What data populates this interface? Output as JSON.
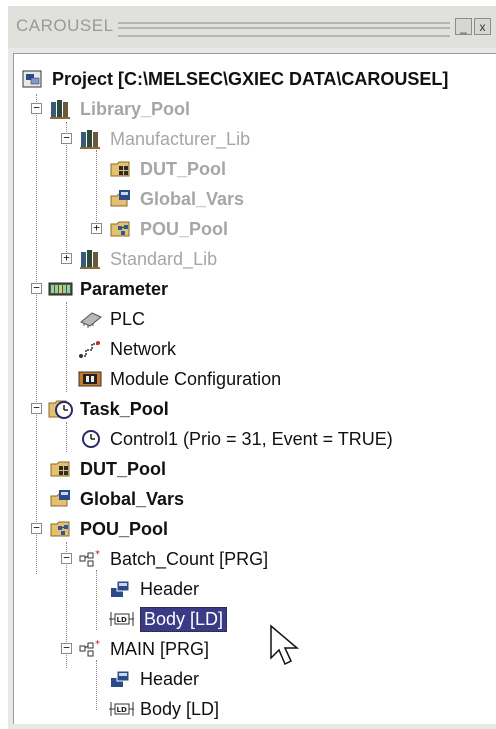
{
  "window": {
    "title": "CAROUSEL",
    "minimize_glyph": "_",
    "close_glyph": "x"
  },
  "tree": {
    "project": "Project [C:\\MELSEC\\GXIEC DATA\\CAROUSEL]",
    "library_pool": "Library_Pool",
    "manufacturer_lib": "Manufacturer_Lib",
    "lib_dut_pool": "DUT_Pool",
    "lib_global_vars": "Global_Vars",
    "lib_pou_pool": "POU_Pool",
    "standard_lib": "Standard_Lib",
    "parameter": "Parameter",
    "plc": "PLC",
    "network": "Network",
    "module_configuration": "Module Configuration",
    "task_pool": "Task_Pool",
    "control1": "Control1 (Prio = 31, Event = TRUE)",
    "dut_pool": "DUT_Pool",
    "global_vars": "Global_Vars",
    "pou_pool": "POU_Pool",
    "batch_count": "Batch_Count [PRG]",
    "batch_header": "Header",
    "batch_body": "Body [LD]",
    "main": "MAIN [PRG]",
    "main_header": "Header",
    "main_body": "Body [LD]"
  },
  "icons": {
    "project": "project-icon",
    "library": "library-books-icon",
    "dut": "dut-pool-icon",
    "global": "global-vars-icon",
    "pou": "pou-pool-icon",
    "parameter": "parameter-icon",
    "plc": "plc-chip-icon",
    "network": "network-icon",
    "module": "module-config-icon",
    "task": "clock-icon",
    "ld_body": "ladder-body-icon"
  },
  "colors": {
    "selection": "#3a3a86",
    "disabled_text": "#a6a6a6"
  }
}
